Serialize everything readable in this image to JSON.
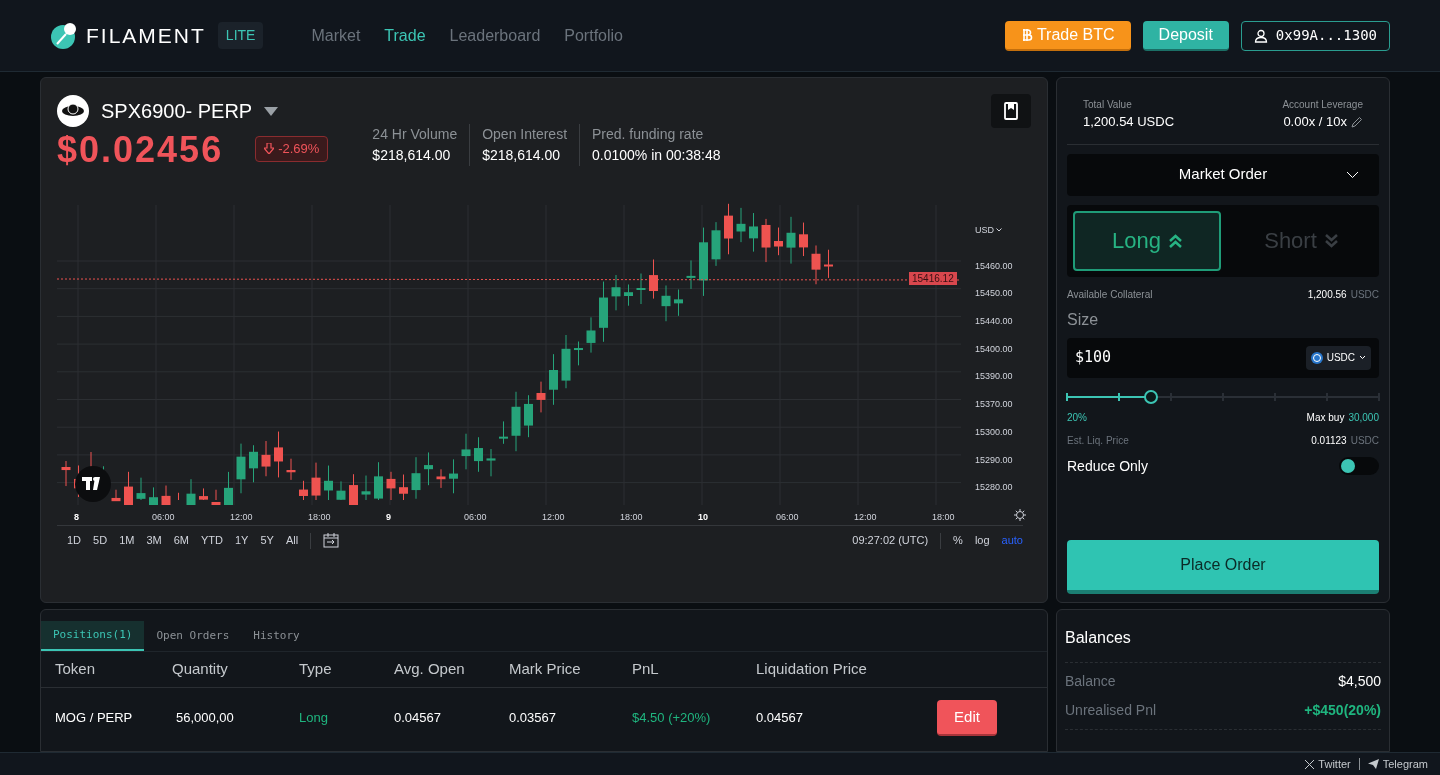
{
  "header": {
    "brand": "FILAMENT",
    "badge": "LITE",
    "nav": [
      {
        "label": "Market",
        "selected": false
      },
      {
        "label": "Trade",
        "selected": true
      },
      {
        "label": "Leaderboard",
        "selected": false
      },
      {
        "label": "Portfolio",
        "selected": false
      }
    ],
    "buttons": [
      {
        "kind": "trade",
        "label": "Trade BTC"
      },
      {
        "kind": "deposit",
        "label": "Deposit"
      },
      {
        "kind": "wallet",
        "label": "0x99A...1300"
      }
    ]
  },
  "market": {
    "symbol": "SPX6900- PERP",
    "price": "$0.02456",
    "change": "-2.69%",
    "stats": [
      {
        "label": "24 Hr Volume",
        "value": "$218,614.00"
      },
      {
        "label": "Open Interest",
        "value": "$218,614.00"
      },
      {
        "label": "Pred. funding rate",
        "value": "0.0100% in 00:38:48"
      }
    ]
  },
  "chart": {
    "currency": "USD",
    "last_price": "15416.12",
    "yticks": [
      "15460.00",
      "15450.00",
      "15440.00",
      "15400.00",
      "15390.00",
      "15370.00",
      "15300.00",
      "15290.00",
      "15280.00"
    ],
    "xticks": [
      {
        "label": "8",
        "kind": "day"
      },
      {
        "label": "06:00",
        "kind": "time"
      },
      {
        "label": "12:00",
        "kind": "time"
      },
      {
        "label": "18:00",
        "kind": "time"
      },
      {
        "label": "9",
        "kind": "day"
      },
      {
        "label": "06:00",
        "kind": "time"
      },
      {
        "label": "12:00",
        "kind": "time"
      },
      {
        "label": "18:00",
        "kind": "time"
      },
      {
        "label": "10",
        "kind": "day"
      },
      {
        "label": "06:00",
        "kind": "time"
      },
      {
        "label": "12:00",
        "kind": "time"
      },
      {
        "label": "18:00",
        "kind": "time"
      }
    ],
    "ranges": [
      {
        "label": "1D",
        "selected": false
      },
      {
        "label": "5D",
        "selected": false
      },
      {
        "label": "1M",
        "selected": false
      },
      {
        "label": "3M",
        "selected": false
      },
      {
        "label": "6M",
        "selected": false
      },
      {
        "label": "YTD",
        "selected": false
      },
      {
        "label": "1Y",
        "selected": false
      },
      {
        "label": "5Y",
        "selected": false
      },
      {
        "label": "All",
        "selected": false
      }
    ],
    "time": "09:27:02 (UTC)",
    "toggles": [
      {
        "label": "%",
        "selected": false
      },
      {
        "label": "log",
        "selected": false
      },
      {
        "label": "auto",
        "selected": true
      }
    ]
  },
  "order": {
    "total_value": {
      "label": "Total Value",
      "value": "1,200.54 USDC"
    },
    "leverage": {
      "label": "Account Leverage",
      "value": "0.00x / 10x"
    },
    "order_type": "Market Order",
    "sides": [
      {
        "kind": "long",
        "label": "Long",
        "selected": true
      },
      {
        "kind": "short",
        "label": "Short",
        "selected": false
      }
    ],
    "collateral": {
      "label": "Available Collateral",
      "value": "1,200.56",
      "unit": "USDC"
    },
    "size": {
      "label": "Size",
      "value": "$100",
      "token": "USDC"
    },
    "slider": {
      "level": 0.27,
      "percent": "20%",
      "max_label": "Max buy",
      "max_value": "30,000"
    },
    "liq": {
      "label": "Est. Liq. Price",
      "value": "0.01123",
      "unit": "USDC"
    },
    "reduce_only": {
      "label": "Reduce Only",
      "on": false
    },
    "submit": "Place Order"
  },
  "positions": {
    "tabs": [
      {
        "label": "Positions(1)",
        "selected": true
      },
      {
        "label": "Open Orders",
        "selected": false
      },
      {
        "label": "History",
        "selected": false
      }
    ],
    "columns": [
      "Token",
      "Quantity",
      "Type",
      "Avg. Open",
      "Mark Price",
      "PnL",
      "Liquidation Price"
    ],
    "rows": [
      {
        "token": "MOG / PERP",
        "quantity": "56,000,00",
        "type": "Long",
        "kind": "long",
        "avg_open": "0.04567",
        "mark_price": "0.03567",
        "pnl": "$4.50 (+20%)",
        "liquidation_price": "0.04567",
        "action": "Edit"
      }
    ]
  },
  "balances": {
    "title": "Balances",
    "rows": [
      {
        "label": "Balance",
        "value": "$4,500",
        "kind": "plain"
      },
      {
        "label": "Unrealised Pnl",
        "value": "+$450(20%)",
        "kind": "gain"
      }
    ]
  },
  "footer": {
    "links": [
      {
        "kind": "x",
        "label": "Twitter"
      },
      {
        "kind": "telegram",
        "label": "Telegram"
      }
    ]
  }
}
